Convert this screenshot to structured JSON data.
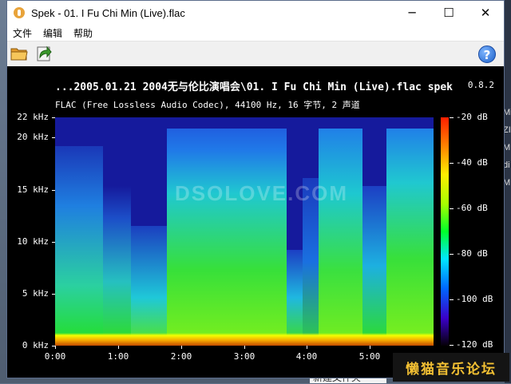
{
  "window": {
    "title": "Spek - 01. I Fu Chi Min (Live).flac",
    "controls": {
      "minimize": "─",
      "maximize": "☐",
      "close": "✕"
    }
  },
  "menu": {
    "items": [
      "文件",
      "编辑",
      "帮助"
    ]
  },
  "toolbar": {
    "help_glyph": "?"
  },
  "spectrogram": {
    "title": "...2005.01.21 2004无与伦比演唱会\\01. I Fu Chi Min (Live).flac",
    "app_name": "spek",
    "version": "0.8.2",
    "info": "FLAC (Free Lossless Audio Codec), 44100 Hz, 16 字节, 2 声道",
    "watermark": "DSOLOVE.COM",
    "y_ticks": [
      "22 kHz",
      "20 kHz",
      "15 kHz",
      "10 kHz",
      "5 kHz",
      "0 kHz"
    ],
    "x_ticks": [
      "0:00",
      "1:00",
      "2:00",
      "3:00",
      "4:00",
      "5:00"
    ],
    "db_ticks": [
      "-20 dB",
      "-40 dB",
      "-60 dB",
      "-80 dB",
      "-100 dB",
      "-120 dB"
    ]
  },
  "desktop": {
    "file_label": "新建文件夹",
    "side_glyphs": [
      "Mi",
      "ZI",
      "M",
      "di",
      "M"
    ]
  },
  "badge": {
    "text": "懒猫音乐论坛"
  },
  "colors": {
    "background": "#151a9c",
    "accent": "#f3c033"
  }
}
